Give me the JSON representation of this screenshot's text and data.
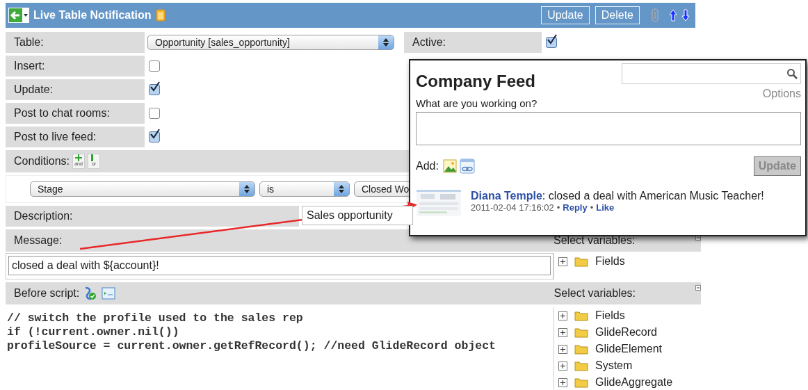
{
  "header": {
    "title": "Live Table Notification",
    "buttons": [
      "Update",
      "Delete"
    ]
  },
  "table_field": {
    "label": "Table:",
    "value": "Opportunity [sales_opportunity]"
  },
  "active": {
    "label": "Active:",
    "checked": true
  },
  "options": [
    {
      "label": "Insert:",
      "checked": false
    },
    {
      "label": "Update:",
      "checked": true
    },
    {
      "label": "Post to chat rooms:",
      "checked": false
    },
    {
      "label": "Post to live feed:",
      "checked": true
    }
  ],
  "conditions": {
    "label": "Conditions:",
    "and_icon": "and",
    "or_icon": "or",
    "selects": [
      "Stage",
      "is",
      "Closed Wo"
    ]
  },
  "description": {
    "label": "Description:",
    "value": "Sales opportunity"
  },
  "message": {
    "label": "Message:",
    "value": "closed a deal with ${account}!",
    "variables_label": "Select variables:",
    "tree": [
      {
        "label": "Fields",
        "expanded": false
      }
    ]
  },
  "before_script": {
    "label": "Before script:",
    "code": [
      "// switch the profile used to the sales rep",
      "if (!current.owner.nil())",
      "profileSource = current.owner.getRefRecord(); //need GlideRecord object"
    ],
    "variables_label": "Select variables:",
    "tree": [
      {
        "label": "Fields",
        "expanded": false
      },
      {
        "label": "GlideRecord",
        "expanded": false
      },
      {
        "label": "GlideElement",
        "expanded": false
      },
      {
        "label": "System",
        "expanded": false
      },
      {
        "label": "GlideAggregate",
        "expanded": false
      }
    ]
  },
  "feed": {
    "title": "Company Feed",
    "options": "Options",
    "prompt": "What are you working on?",
    "add_label": "Add:",
    "update_button": {
      "label": "Update",
      "disabled": true
    },
    "post": {
      "author": "Diana Temple",
      "text": ": closed a deal with American Music Teacher!",
      "time": "2011-02-04 17:16:02",
      "separator": "•",
      "actions": [
        "Reply",
        "Like"
      ]
    }
  }
}
